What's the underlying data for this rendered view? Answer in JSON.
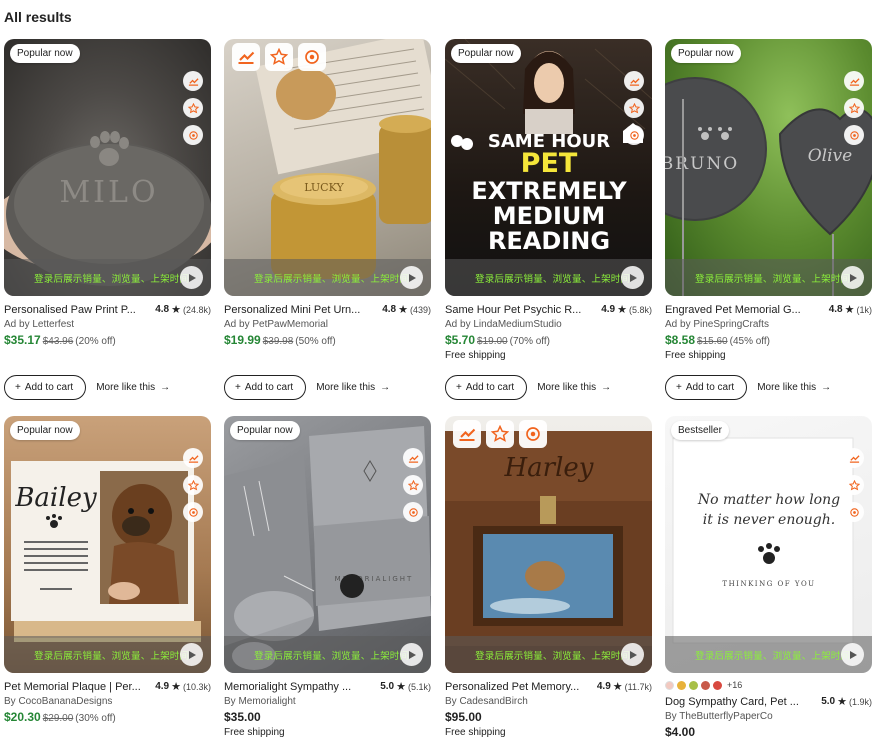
{
  "heading": "All results",
  "overlay_text": "登录后展示销量、浏览量、上架时间",
  "add_to_cart": "Add to cart",
  "more_like_this": "More like this",
  "cards": [
    {
      "badge": "Popular now",
      "title": "Personalised Paw Print P...",
      "rating": "4.8",
      "count": "(24.8k)",
      "seller": "Ad by Letterfest",
      "price": "$35.17",
      "orig": "$43.96",
      "discount": "(20% off)",
      "shipping": ""
    },
    {
      "badge": "",
      "title": "Personalized Mini Pet Urn...",
      "rating": "4.8",
      "count": "(439)",
      "seller": "Ad by PetPawMemorial",
      "price": "$19.99",
      "orig": "$39.98",
      "discount": "(50% off)",
      "shipping": ""
    },
    {
      "badge": "Popular now",
      "title": "Same Hour Pet Psychic R...",
      "rating": "4.9",
      "count": "(5.8k)",
      "seller": "Ad by LindaMediumStudio",
      "price": "$5.70",
      "orig": "$19.00",
      "discount": "(70% off)",
      "shipping": "Free shipping",
      "image_text": [
        "SAME HOUR",
        "PET",
        "EXTREMELY",
        "MEDIUM",
        "READING"
      ]
    },
    {
      "badge": "Popular now",
      "title": "Engraved Pet Memorial G...",
      "rating": "4.8",
      "count": "(1k)",
      "seller": "Ad by PineSpringCrafts",
      "price": "$8.58",
      "orig": "$15.60",
      "discount": "(45% off)",
      "shipping": "Free shipping"
    },
    {
      "badge": "Popular now",
      "title": "Pet Memorial Plaque | Per...",
      "rating": "4.9",
      "count": "(10.3k)",
      "seller": "By CocoBananaDesigns",
      "price": "$20.30",
      "orig": "$29.00",
      "discount": "(30% off)",
      "shipping": ""
    },
    {
      "badge": "Popular now",
      "title": "Memorialight Sympathy ...",
      "rating": "5.0",
      "count": "(5.1k)",
      "seller": "By Memorialight",
      "price": "$35.00",
      "orig": "",
      "discount": "",
      "shipping": "Free shipping"
    },
    {
      "badge": "",
      "title": "Personalized Pet Memory...",
      "rating": "4.9",
      "count": "(11.7k)",
      "seller": "By CadesandBirch",
      "price": "$95.00",
      "orig": "",
      "discount": "",
      "shipping": "Free shipping"
    },
    {
      "badge": "Bestseller",
      "title": "Dog Sympathy Card, Pet ...",
      "rating": "5.0",
      "count": "(1.9k)",
      "seller": "By TheButterflyPaperCo",
      "price": "$4.00",
      "orig": "",
      "discount": "",
      "shipping": "",
      "swatch_more": "+16",
      "swatch_colors": [
        "#f2c9c0",
        "#e8b23a",
        "#a8c048",
        "#c85a4a",
        "#d84a40"
      ]
    }
  ],
  "colors": {
    "sale_price": "#258635",
    "overlay_text": "#8cf03a",
    "icon_orange": "#f1641e"
  }
}
